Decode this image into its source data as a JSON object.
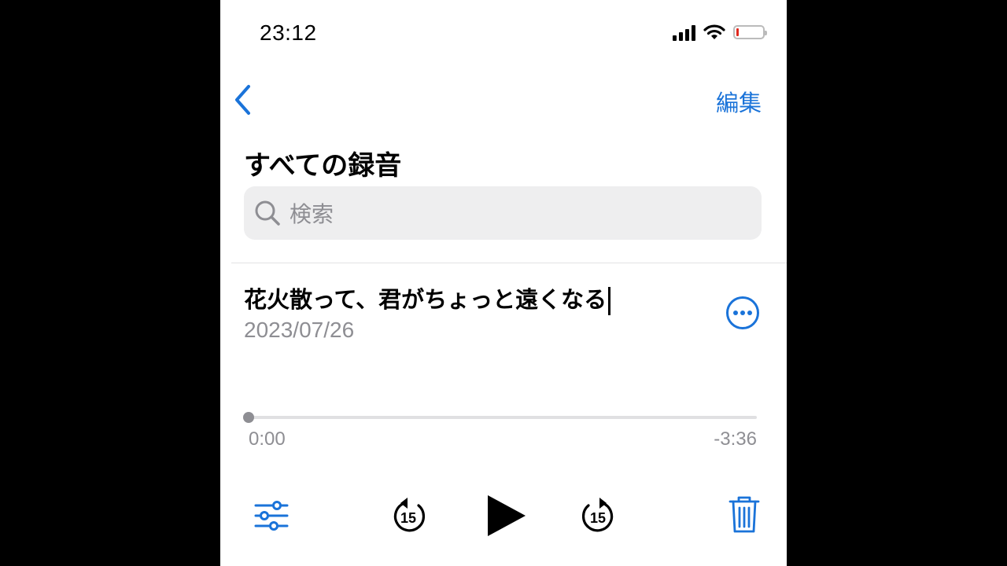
{
  "status_bar": {
    "time": "23:12"
  },
  "nav": {
    "edit_label": "編集"
  },
  "page": {
    "title": "すべての録音"
  },
  "search": {
    "placeholder": "検索"
  },
  "recording": {
    "title": "花火散って、君がちょっと遠くなる",
    "date": "2023/07/26",
    "elapsed": "0:00",
    "remaining": "-3:36",
    "progress": 0
  },
  "controls": {
    "skip_back_seconds": "15",
    "skip_forward_seconds": "15"
  },
  "colors": {
    "accent": "#1a73d9",
    "battery_low": "#e0281e",
    "secondary_text": "#8e8e93"
  },
  "icons": [
    "chevron-left-icon",
    "search-icon",
    "more-icon",
    "settings-sliders-icon",
    "skip-back-15-icon",
    "play-icon",
    "skip-forward-15-icon",
    "trash-icon",
    "wifi-icon",
    "signal-icon",
    "battery-icon"
  ]
}
